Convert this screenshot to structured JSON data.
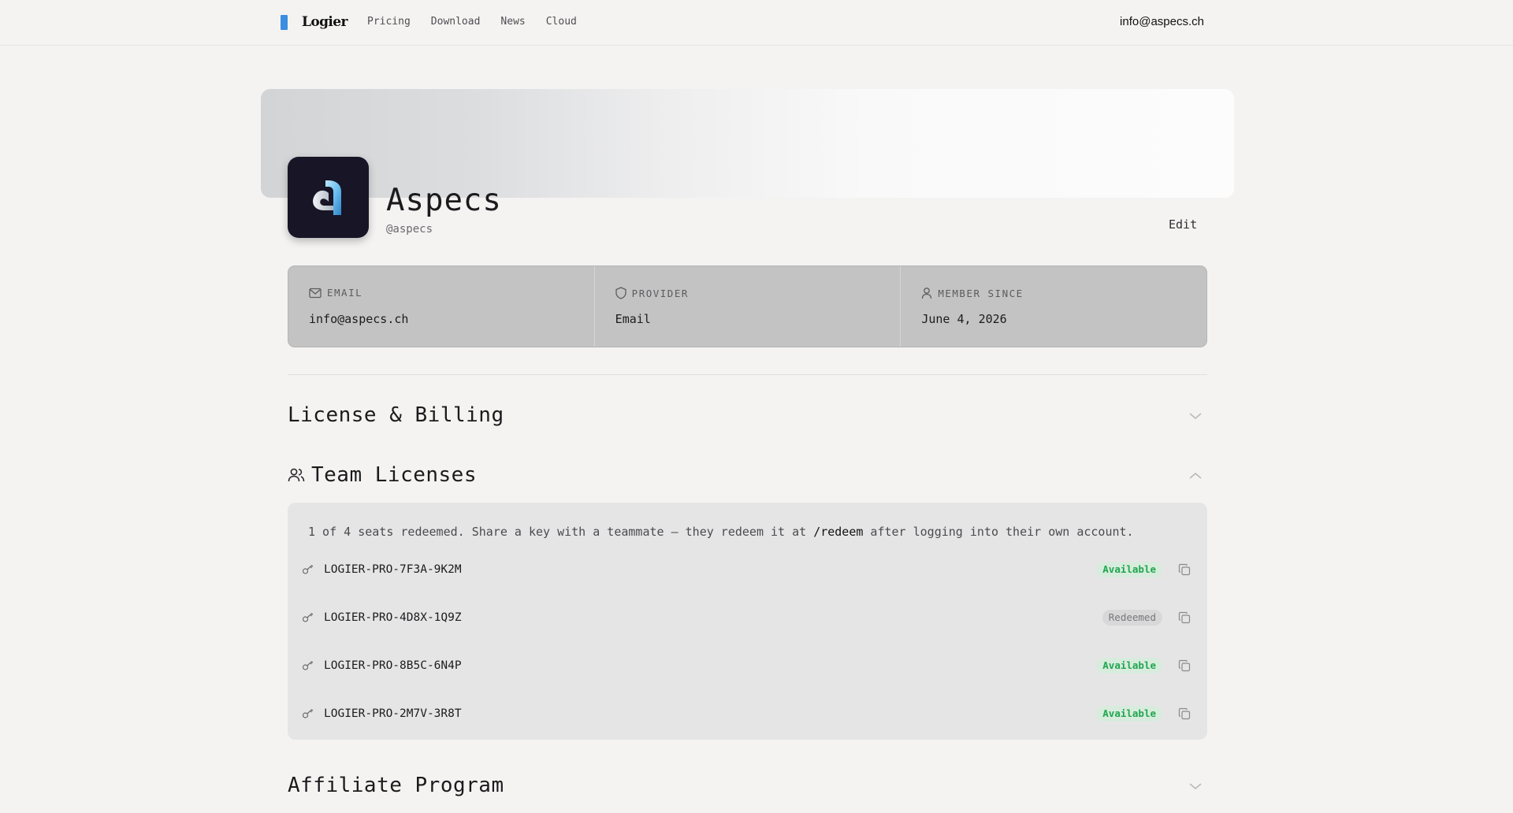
{
  "nav": {
    "brand": "Logier",
    "links": [
      "Pricing",
      "Download",
      "News",
      "Cloud"
    ],
    "user_email": "info@aspecs.ch"
  },
  "profile": {
    "name": "Aspecs",
    "handle": "@aspecs",
    "edit_label": "Edit"
  },
  "info": {
    "email_label": "EMAIL",
    "email_value": "info@aspecs.ch",
    "provider_label": "PROVIDER",
    "provider_value": "Email",
    "member_label": "MEMBER SINCE",
    "member_value": "June 4, 2026"
  },
  "sections": {
    "license_billing": "License & Billing",
    "team_licenses": "Team Licenses",
    "affiliate": "Affiliate Program"
  },
  "team": {
    "note_prefix": "1 of 4 seats redeemed. Share a key with a teammate — they redeem it at ",
    "note_cmd": "/redeem",
    "note_suffix": " after logging into their own account.",
    "keys": [
      {
        "code": "LOGIER-PRO-7F3A-9K2M",
        "status": "Available"
      },
      {
        "code": "LOGIER-PRO-4D8X-1Q9Z",
        "status": "Redeemed"
      },
      {
        "code": "LOGIER-PRO-8B5C-6N4P",
        "status": "Available"
      },
      {
        "code": "LOGIER-PRO-2M7V-3R8T",
        "status": "Available"
      }
    ]
  },
  "colors": {
    "brand_accent": "#3b8ee0",
    "available": "#21a64f",
    "redeemed": "#77767a"
  },
  "icons": [
    "mail-icon",
    "shield-icon",
    "user-icon",
    "users-icon",
    "key-icon",
    "copy-icon",
    "chevron-down-icon",
    "chevron-up-icon"
  ]
}
